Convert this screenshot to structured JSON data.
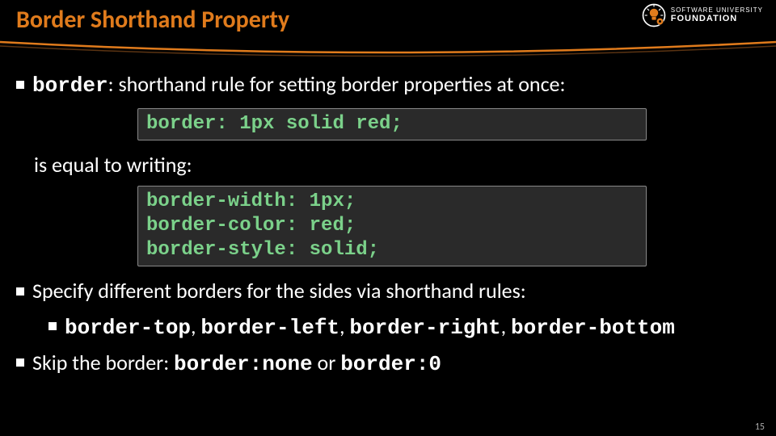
{
  "title": "Border Shorthand Property",
  "logo": {
    "line1": "SOFTWARE UNIVERSITY",
    "line2": "FOUNDATION"
  },
  "bullets": {
    "b1_code": "border",
    "b1_rest": ": shorthand rule for setting border properties at once:",
    "code1": "border: 1px solid red;",
    "equal": "is equal to writing:",
    "code2_l1": "border-width: 1px;",
    "code2_l2": "border-color: red;",
    "code2_l3": "border-style: solid;",
    "b2": "Specify different borders for the sides via shorthand rules:",
    "b2_sub_1": "border-top",
    "b2_sub_2": "border-left",
    "b2_sub_3": "border-right",
    "b2_sub_4": "border-bottom",
    "b3_pre": "Skip the border: ",
    "b3_c1": "border:none",
    "b3_mid": " or ",
    "b3_c2": "border:0"
  },
  "page": "15"
}
